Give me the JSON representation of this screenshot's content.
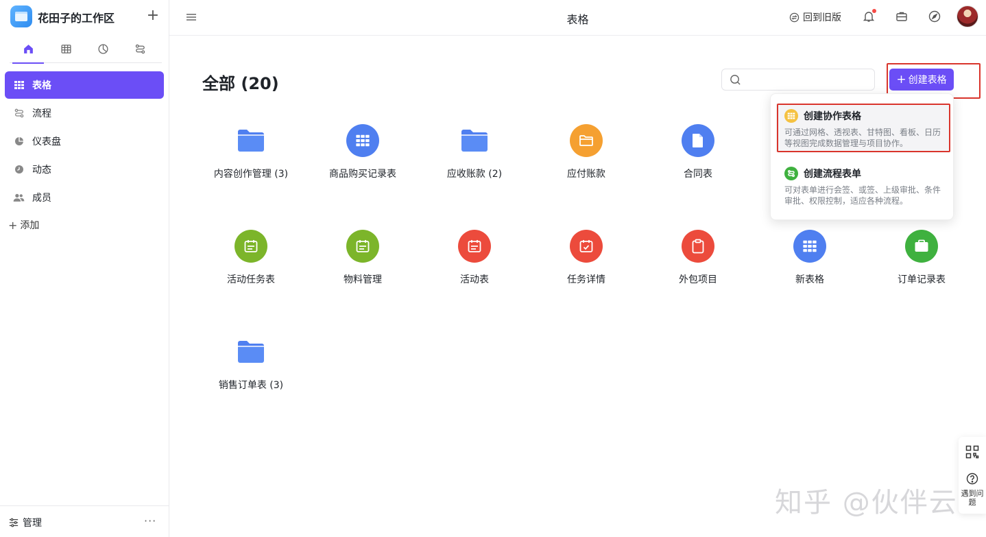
{
  "workspace": {
    "title": "花田子的工作区"
  },
  "sidebar": {
    "nav": [
      {
        "label": "表格",
        "icon": "grid-icon",
        "active": true
      },
      {
        "label": "流程",
        "icon": "flow-icon"
      },
      {
        "label": "仪表盘",
        "icon": "dashboard-icon"
      },
      {
        "label": "动态",
        "icon": "clock-icon"
      },
      {
        "label": "成员",
        "icon": "members-icon"
      }
    ],
    "add_label": "添加",
    "manage_label": "管理",
    "more_label": "···"
  },
  "topbar": {
    "title": "表格",
    "back_old_label": "回到旧版"
  },
  "main": {
    "heading": "全部 (20)",
    "search_placeholder": "",
    "create_label": "创建表格",
    "tiles": [
      {
        "label": "内容创作管理 (3)",
        "type": "folder",
        "color": "#4f7ff0"
      },
      {
        "label": "商品购买记录表",
        "type": "table",
        "color": "#4f7ff0"
      },
      {
        "label": "应收账款 (2)",
        "type": "folder",
        "color": "#4f7ff0"
      },
      {
        "label": "应付账款",
        "type": "folder-circle",
        "color": "#f5a031"
      },
      {
        "label": "合同表",
        "type": "doc",
        "color": "#4f7ff0"
      },
      {
        "label": "活动任务表",
        "type": "calendar",
        "color": "#7cb52a"
      },
      {
        "label": "物料管理",
        "type": "calendar",
        "color": "#7cb52a"
      },
      {
        "label": "活动表",
        "type": "calendar",
        "color": "#ec4b3c"
      },
      {
        "label": "任务详情",
        "type": "calendar-check",
        "color": "#ec4b3c"
      },
      {
        "label": "外包项目",
        "type": "clipboard",
        "color": "#ec4b3c"
      },
      {
        "label": "新表格",
        "type": "table",
        "color": "#4f7ff0"
      },
      {
        "label": "订单记录表",
        "type": "briefcase",
        "color": "#3fb13f"
      },
      {
        "label": "销售订单表 (3)",
        "type": "folder",
        "color": "#4f7ff0"
      }
    ]
  },
  "dropdown": {
    "items": [
      {
        "title": "创建协作表格",
        "desc": "可通过网格、透视表、甘特图、看板、日历等视图完成数据管理与项目协作。",
        "color": "#f5c242"
      },
      {
        "title": "创建流程表单",
        "desc": "可对表单进行会签、或签、上级审批、条件审批、权限控制，适应各种流程。",
        "color": "#3fb13f"
      }
    ]
  },
  "float": {
    "help_label": "遇到问题"
  },
  "watermark": "知乎 @伙伴云"
}
